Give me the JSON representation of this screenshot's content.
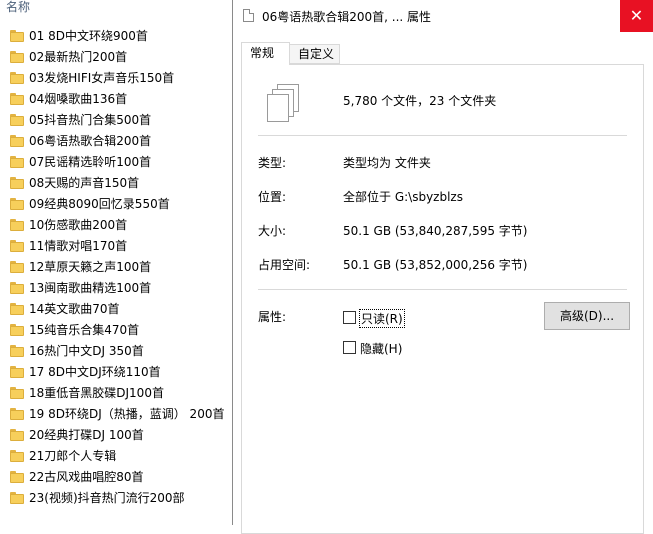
{
  "explorer": {
    "column_header": "名称",
    "items": [
      {
        "name": "01 8D中文环绕900首"
      },
      {
        "name": "02最新热门200首"
      },
      {
        "name": "03发烧HIFI女声音乐150首"
      },
      {
        "name": "04烟嗓歌曲136首"
      },
      {
        "name": "05抖音热门合集500首"
      },
      {
        "name": "06粤语热歌合辑200首"
      },
      {
        "name": "07民谣精选聆听100首"
      },
      {
        "name": "08天赐的声音150首"
      },
      {
        "name": "09经典8090回忆录550首"
      },
      {
        "name": "10伤感歌曲200首"
      },
      {
        "name": "11情歌对唱170首"
      },
      {
        "name": "12草原天籁之声100首"
      },
      {
        "name": "13闽南歌曲精选100首"
      },
      {
        "name": "14英文歌曲70首"
      },
      {
        "name": "15纯音乐合集470首"
      },
      {
        "name": "16热门中文DJ 350首"
      },
      {
        "name": "17 8D中文DJ环绕110首"
      },
      {
        "name": "18重低音黑胶碟DJ100首"
      },
      {
        "name": "19 8D环绕DJ（热播，蓝调）  200首"
      },
      {
        "name": "20经典打碟DJ 100首"
      },
      {
        "name": "21刀郎个人专辑"
      },
      {
        "name": "22古风戏曲唱腔80首"
      },
      {
        "name": "23(视频)抖音热门流行200部"
      }
    ],
    "folder_icon_color": "#f7cf5b"
  },
  "dialog": {
    "title": "06粤语热歌合辑200首, ... 属性",
    "close_glyph": "✕",
    "close_color": "#e81123",
    "tabs": [
      {
        "label": "常规",
        "active": true
      },
      {
        "label": "自定义",
        "active": false
      }
    ],
    "summary": "5,780 个文件，23 个文件夹",
    "fields": {
      "type_label": "类型:",
      "type_value": "类型均为 文件夹",
      "location_label": "位置:",
      "location_value": "全部位于 G:\\sbyzblzs",
      "size_label": "大小:",
      "size_value": "50.1 GB (53,840,287,595 字节)",
      "disk_label": "占用空间:",
      "disk_value": "50.1 GB (53,852,000,256 字节)"
    },
    "attributes": {
      "label": "属性:",
      "readonly_label": "只读(R)",
      "readonly_checked": false,
      "hidden_label": "隐藏(H)",
      "hidden_checked": false,
      "advanced_button": "高级(D)..."
    }
  }
}
